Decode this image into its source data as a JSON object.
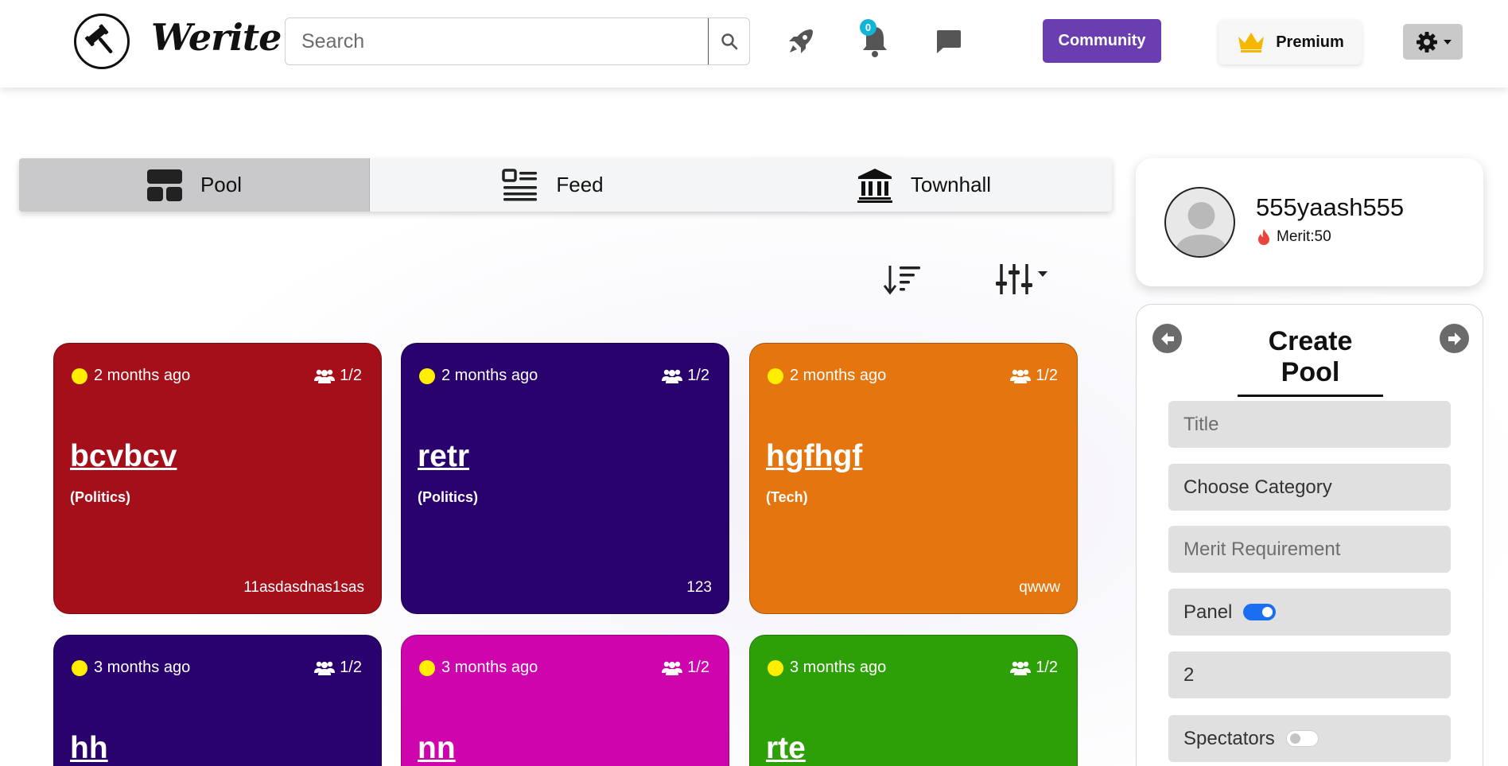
{
  "app": {
    "name": "Werite"
  },
  "header": {
    "search_placeholder": "Search",
    "notification_count": "0",
    "community_label": "Community",
    "premium_label": "Premium"
  },
  "tabs": [
    {
      "label": "Pool",
      "active": true
    },
    {
      "label": "Feed",
      "active": false
    },
    {
      "label": "Townhall",
      "active": false
    }
  ],
  "pools": [
    {
      "time": "2 months ago",
      "members": "1/2",
      "title": "bcvbcv",
      "category": "(Politics)",
      "author": "11asdasdnas1sas",
      "color": "#a50f1a"
    },
    {
      "time": "2 months ago",
      "members": "1/2",
      "title": "retr",
      "category": "(Politics)",
      "author": "123",
      "color": "#29026d"
    },
    {
      "time": "2 months ago",
      "members": "1/2",
      "title": "hgfhgf",
      "category": "(Tech)",
      "author": "qwww",
      "color": "#e5760f"
    },
    {
      "time": "3 months ago",
      "members": "1/2",
      "title": "hh",
      "color": "#29026d"
    },
    {
      "time": "3 months ago",
      "members": "1/2",
      "title": "nn",
      "color": "#ce05ad"
    },
    {
      "time": "3 months ago",
      "members": "1/2",
      "title": "rte",
      "color": "#2ea007"
    }
  ],
  "profile": {
    "username": "555yaash555",
    "merit": "Merit:50"
  },
  "create_pool": {
    "heading": "Create Pool",
    "title_placeholder": "Title",
    "category_placeholder": "Choose Category",
    "merit_placeholder": "Merit Requirement",
    "panel_label": "Panel",
    "panel_enabled": true,
    "capacity_value": "2",
    "spectators_label": "Spectators",
    "spectators_enabled": false
  }
}
